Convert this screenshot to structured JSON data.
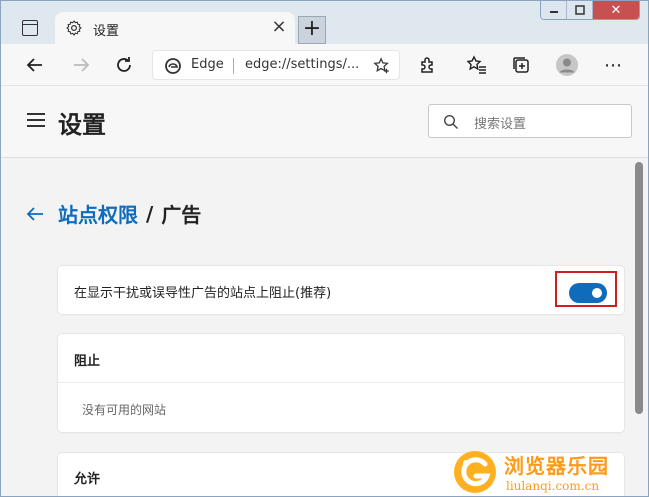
{
  "window": {
    "tab_title": "设置",
    "close_glyph": "×",
    "newtab_glyph": "+",
    "winclose_glyph": "✕"
  },
  "toolbar": {
    "site_name": "Edge",
    "url": "edge://settings/...",
    "more_glyph": "⋯"
  },
  "header": {
    "title": "设置",
    "search_placeholder": "搜索设置"
  },
  "breadcrumb": {
    "parent": "站点权限",
    "separator": "/",
    "current": "广告"
  },
  "block_toggle": {
    "label": "在显示干扰或误导性广告的站点上阻止(推荐)",
    "on": true
  },
  "block_list": {
    "heading": "阻止",
    "empty_text": "没有可用的网站"
  },
  "allow_list": {
    "heading": "允许"
  },
  "watermark": {
    "title": "浏览器乐园",
    "subtitle": "liulanqi.com.cn"
  },
  "colors": {
    "accent": "#0f6cbd",
    "highlight_border": "#cc2020",
    "watermark": "#ff9a18"
  }
}
